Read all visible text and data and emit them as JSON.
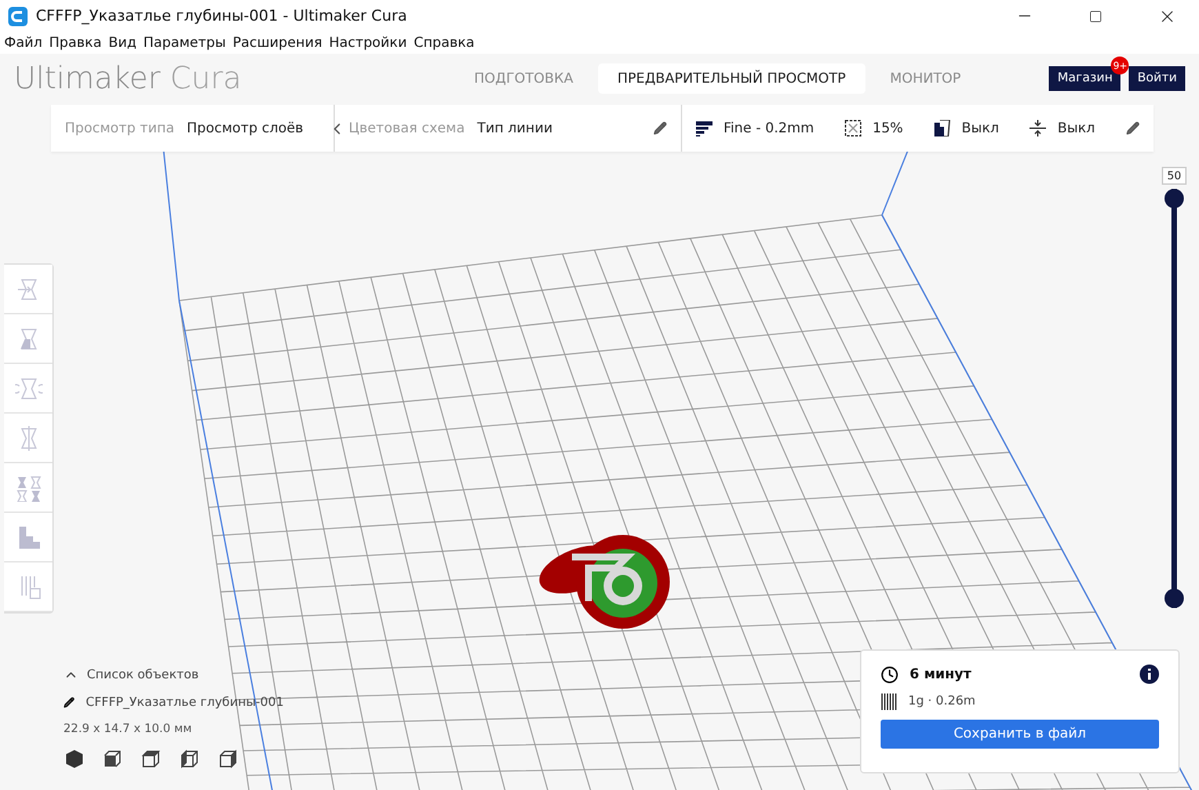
{
  "window": {
    "title": "CFFFP_Указатлье глубины-001 - Ultimaker Cura"
  },
  "menu": [
    "Файл",
    "Правка",
    "Вид",
    "Параметры",
    "Расширения",
    "Настройки",
    "Справка"
  ],
  "header": {
    "logo": {
      "brand": "Ultimaker",
      "product": "Cura"
    },
    "stages": [
      {
        "label": "ПОДГОТОВКА",
        "selected": false
      },
      {
        "label": "ПРЕДВАРИТЕЛЬНЫЙ ПРОСМОТР",
        "selected": true
      },
      {
        "label": "МОНИТОР",
        "selected": false
      }
    ],
    "marketplace": {
      "label": "Магазин",
      "badge": "9+"
    },
    "login": {
      "label": "Войти"
    }
  },
  "view_toolbar": {
    "view_type": {
      "label": "Просмотр типа",
      "value": "Просмотр слоёв"
    },
    "color_scheme": {
      "label": "Цветовая схема",
      "value": "Тип линии"
    }
  },
  "print_setup": {
    "profile": "Fine - 0.2mm",
    "infill": "15%",
    "support": "Выкл",
    "adhesion": "Выкл"
  },
  "tools": [
    {
      "kind": "move",
      "selected": false
    },
    {
      "kind": "scale",
      "selected": false
    },
    {
      "kind": "rotate",
      "selected": false
    },
    {
      "kind": "mirror",
      "selected": false
    },
    {
      "kind": "per-model",
      "selected": false
    },
    {
      "kind": "support",
      "selected": false
    },
    {
      "kind": "blocker",
      "selected": false
    }
  ],
  "layer_slider": {
    "reading": "50",
    "upper": {
      "level": 1
    },
    "lower": {
      "level": 0
    }
  },
  "object_list": {
    "title": "Список объектов",
    "expanded": true,
    "object_name": "CFFFP_Указатлье глубины-001",
    "dimensions": "22.9 x 14.7 x 10.0 мм"
  },
  "camera_views": [
    {
      "kind": "iso"
    },
    {
      "kind": "front"
    },
    {
      "kind": "top"
    },
    {
      "kind": "left"
    },
    {
      "kind": "right"
    }
  ],
  "print_panel": {
    "time": "6 минут",
    "material": "1g · 0.26m",
    "button": "Сохранить в файл"
  }
}
